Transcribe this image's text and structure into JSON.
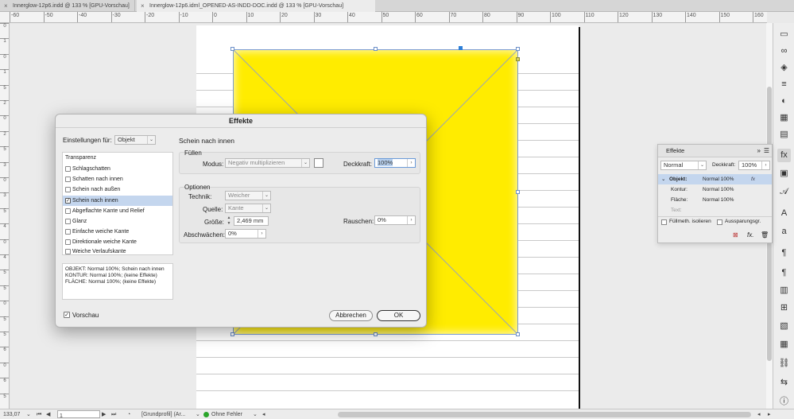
{
  "tabs": [
    {
      "label": "Innerglow-12p6.indd @ 133 % [GPU-Vorschau]",
      "close": "×"
    },
    {
      "label": "Innerglow-12p6.idml_OPENED-AS-INDD-DOC.indd @ 133 % [GPU-Vorschau]",
      "close": "×"
    }
  ],
  "ruler_h": [
    "-60",
    "-50",
    "-40",
    "-30",
    "-20",
    "-10",
    "0",
    "10",
    "20",
    "30",
    "40",
    "50",
    "60",
    "70",
    "80",
    "90",
    "100",
    "110",
    "120",
    "130",
    "140",
    "150",
    "160"
  ],
  "ruler_v": [
    "0",
    "1",
    "0",
    "1",
    "5",
    "2",
    "0",
    "2",
    "5",
    "3",
    "0",
    "3",
    "5",
    "4",
    "0",
    "4",
    "5",
    "5",
    "0",
    "5",
    "5",
    "6",
    "0",
    "6",
    "5"
  ],
  "dialog": {
    "title": "Effekte",
    "settings_for_label": "Einstellungen für:",
    "settings_for_value": "Objekt",
    "section_title": "Schein nach innen",
    "list_header": "Transparenz",
    "list": [
      {
        "label": "Schlagschatten",
        "checked": false
      },
      {
        "label": "Schatten nach innen",
        "checked": false
      },
      {
        "label": "Schein nach außen",
        "checked": false
      },
      {
        "label": "Schein nach innen",
        "checked": true
      },
      {
        "label": "Abgeflachte Kante und Relief",
        "checked": false
      },
      {
        "label": "Glanz",
        "checked": false
      },
      {
        "label": "Einfache weiche Kante",
        "checked": false
      },
      {
        "label": "Direktionale weiche Kante",
        "checked": false
      },
      {
        "label": "Weiche Verlaufskante",
        "checked": false
      }
    ],
    "summary": [
      "OBJEKT: Normal 100%; Schein nach innen",
      "KONTUR: Normal 100%; (keine Effekte)",
      "FLÄCHE: Normal 100%; (keine Effekte)"
    ],
    "fill_group": "Füllen",
    "mode_label": "Modus:",
    "mode_value": "Negativ multiplizieren",
    "opacity_label": "Deckkraft:",
    "opacity_value": "100%",
    "options_group": "Optionen",
    "technique_label": "Technik:",
    "technique_value": "Weicher",
    "source_label": "Quelle:",
    "source_value": "Kante",
    "size_label": "Größe:",
    "size_value": "2,469 mm",
    "choke_label": "Abschwächen:",
    "choke_value": "0%",
    "noise_label": "Rauschen:",
    "noise_value": "0%",
    "preview_label": "Vorschau",
    "preview_checked": true,
    "cancel_label": "Abbrechen",
    "ok_label": "OK"
  },
  "effects_panel": {
    "title": "Effekte",
    "blend_mode": "Normal",
    "opacity_label": "Deckkraft:",
    "opacity_value": "100%",
    "rows": [
      {
        "name": "Objekt:",
        "value": "Normal 100%",
        "fx": "fx"
      },
      {
        "name": "Kontur:",
        "value": "Normal 100%"
      },
      {
        "name": "Fläche:",
        "value": "Normal 100%"
      },
      {
        "name": "Text:",
        "value": ""
      }
    ],
    "isolate_label": "Füllmeth. isolieren",
    "knockout_label": "Aussparungsgr."
  },
  "status": {
    "zoom": "133,07",
    "page": "1",
    "profile": "[Grundprofil] (Ar...",
    "errors": "Ohne Fehler",
    "accent_ok": "#2aa52a"
  },
  "colors": {
    "frame_fill": "#ffec00",
    "selection": "#c4d6ee"
  }
}
